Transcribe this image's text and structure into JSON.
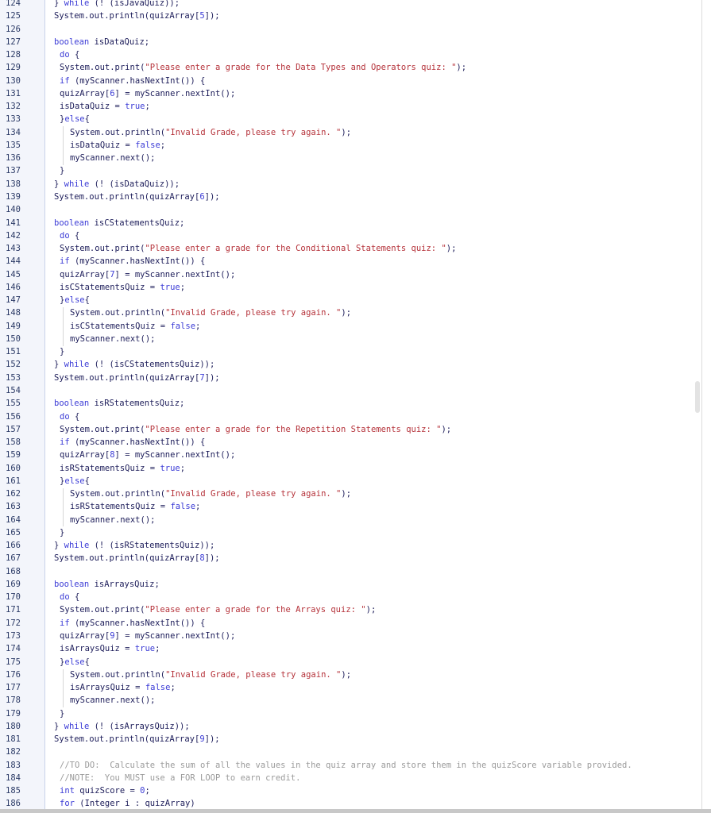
{
  "editor": {
    "colors": {
      "keyword": "#3b3bd6",
      "string": "#b5323a",
      "literal": "#3b3bd6",
      "comment": "#9a9a9a",
      "plain": "#1d1d5a",
      "line_number": "#2b3a66",
      "gutter_background": "#f3f5fb"
    },
    "lines": [
      {
        "n": "124",
        "indent": 0,
        "tokens": [
          [
            "p",
            "} "
          ],
          [
            "k",
            "while"
          ],
          [
            "p",
            " (! (isJavaQuiz));"
          ]
        ]
      },
      {
        "n": "125",
        "indent": 0,
        "tokens": [
          [
            "p",
            "System.out.println(quizArray["
          ],
          [
            "k",
            "5"
          ],
          [
            "p",
            "]);"
          ]
        ]
      },
      {
        "n": "126",
        "indent": 0,
        "tokens": []
      },
      {
        "n": "127",
        "indent": 0,
        "tokens": [
          [
            "k",
            "boolean"
          ],
          [
            "p",
            " isDataQuiz;"
          ]
        ]
      },
      {
        "n": "128",
        "indent": 1,
        "tokens": [
          [
            "k",
            "do"
          ],
          [
            "p",
            " {"
          ]
        ]
      },
      {
        "n": "129",
        "indent": 1,
        "tokens": [
          [
            "p",
            "System.out.print("
          ],
          [
            "s",
            "\"Please enter a grade for the Data Types and Operators quiz: \""
          ],
          [
            "p",
            ");"
          ]
        ]
      },
      {
        "n": "130",
        "indent": 1,
        "tokens": [
          [
            "k",
            "if"
          ],
          [
            "p",
            " (myScanner.hasNextInt()) {"
          ]
        ]
      },
      {
        "n": "131",
        "indent": 1,
        "tokens": [
          [
            "p",
            "quizArray["
          ],
          [
            "k",
            "6"
          ],
          [
            "p",
            "] = myScanner.nextInt();"
          ]
        ]
      },
      {
        "n": "132",
        "indent": 1,
        "tokens": [
          [
            "p",
            "isDataQuiz = "
          ],
          [
            "k",
            "true"
          ],
          [
            "p",
            ";"
          ]
        ]
      },
      {
        "n": "133",
        "indent": 1,
        "tokens": [
          [
            "p",
            "}"
          ],
          [
            "k",
            "else"
          ],
          [
            "p",
            "{"
          ]
        ]
      },
      {
        "n": "134",
        "indent": 3,
        "tokens": [
          [
            "p",
            "System.out.println("
          ],
          [
            "s",
            "\"Invalid Grade, please try again. \""
          ],
          [
            "p",
            ");"
          ]
        ]
      },
      {
        "n": "135",
        "indent": 3,
        "tokens": [
          [
            "p",
            "isDataQuiz = "
          ],
          [
            "k",
            "false"
          ],
          [
            "p",
            ";"
          ]
        ]
      },
      {
        "n": "136",
        "indent": 3,
        "tokens": [
          [
            "p",
            "myScanner.next();"
          ]
        ]
      },
      {
        "n": "137",
        "indent": 1,
        "tokens": [
          [
            "p",
            "}"
          ]
        ]
      },
      {
        "n": "138",
        "indent": 0,
        "tokens": [
          [
            "p",
            "} "
          ],
          [
            "k",
            "while"
          ],
          [
            "p",
            " (! (isDataQuiz));"
          ]
        ]
      },
      {
        "n": "139",
        "indent": 0,
        "tokens": [
          [
            "p",
            "System.out.println(quizArray["
          ],
          [
            "k",
            "6"
          ],
          [
            "p",
            "]);"
          ]
        ]
      },
      {
        "n": "140",
        "indent": 0,
        "tokens": []
      },
      {
        "n": "141",
        "indent": 0,
        "tokens": [
          [
            "k",
            "boolean"
          ],
          [
            "p",
            " isCStatementsQuiz;"
          ]
        ]
      },
      {
        "n": "142",
        "indent": 1,
        "tokens": [
          [
            "k",
            "do"
          ],
          [
            "p",
            " {"
          ]
        ]
      },
      {
        "n": "143",
        "indent": 1,
        "tokens": [
          [
            "p",
            "System.out.print("
          ],
          [
            "s",
            "\"Please enter a grade for the Conditional Statements quiz: \""
          ],
          [
            "p",
            ");"
          ]
        ]
      },
      {
        "n": "144",
        "indent": 1,
        "tokens": [
          [
            "k",
            "if"
          ],
          [
            "p",
            " (myScanner.hasNextInt()) {"
          ]
        ]
      },
      {
        "n": "145",
        "indent": 1,
        "tokens": [
          [
            "p",
            "quizArray["
          ],
          [
            "k",
            "7"
          ],
          [
            "p",
            "] = myScanner.nextInt();"
          ]
        ]
      },
      {
        "n": "146",
        "indent": 1,
        "tokens": [
          [
            "p",
            "isCStatementsQuiz = "
          ],
          [
            "k",
            "true"
          ],
          [
            "p",
            ";"
          ]
        ]
      },
      {
        "n": "147",
        "indent": 1,
        "tokens": [
          [
            "p",
            "}"
          ],
          [
            "k",
            "else"
          ],
          [
            "p",
            "{"
          ]
        ]
      },
      {
        "n": "148",
        "indent": 3,
        "tokens": [
          [
            "p",
            "System.out.println("
          ],
          [
            "s",
            "\"Invalid Grade, please try again. \""
          ],
          [
            "p",
            ");"
          ]
        ]
      },
      {
        "n": "149",
        "indent": 3,
        "tokens": [
          [
            "p",
            "isCStatementsQuiz = "
          ],
          [
            "k",
            "false"
          ],
          [
            "p",
            ";"
          ]
        ]
      },
      {
        "n": "150",
        "indent": 3,
        "tokens": [
          [
            "p",
            "myScanner.next();"
          ]
        ]
      },
      {
        "n": "151",
        "indent": 1,
        "tokens": [
          [
            "p",
            "}"
          ]
        ]
      },
      {
        "n": "152",
        "indent": 0,
        "tokens": [
          [
            "p",
            "} "
          ],
          [
            "k",
            "while"
          ],
          [
            "p",
            " (! (isCStatementsQuiz));"
          ]
        ]
      },
      {
        "n": "153",
        "indent": 0,
        "tokens": [
          [
            "p",
            "System.out.println(quizArray["
          ],
          [
            "k",
            "7"
          ],
          [
            "p",
            "]);"
          ]
        ]
      },
      {
        "n": "154",
        "indent": 0,
        "tokens": []
      },
      {
        "n": "155",
        "indent": 0,
        "tokens": [
          [
            "k",
            "boolean"
          ],
          [
            "p",
            " isRStatementsQuiz;"
          ]
        ]
      },
      {
        "n": "156",
        "indent": 1,
        "tokens": [
          [
            "k",
            "do"
          ],
          [
            "p",
            " {"
          ]
        ]
      },
      {
        "n": "157",
        "indent": 1,
        "tokens": [
          [
            "p",
            "System.out.print("
          ],
          [
            "s",
            "\"Please enter a grade for the Repetition Statements quiz: \""
          ],
          [
            "p",
            ");"
          ]
        ]
      },
      {
        "n": "158",
        "indent": 1,
        "tokens": [
          [
            "k",
            "if"
          ],
          [
            "p",
            " (myScanner.hasNextInt()) {"
          ]
        ]
      },
      {
        "n": "159",
        "indent": 1,
        "tokens": [
          [
            "p",
            "quizArray["
          ],
          [
            "k",
            "8"
          ],
          [
            "p",
            "] = myScanner.nextInt();"
          ]
        ]
      },
      {
        "n": "160",
        "indent": 1,
        "tokens": [
          [
            "p",
            "isRStatementsQuiz = "
          ],
          [
            "k",
            "true"
          ],
          [
            "p",
            ";"
          ]
        ]
      },
      {
        "n": "161",
        "indent": 1,
        "tokens": [
          [
            "p",
            "}"
          ],
          [
            "k",
            "else"
          ],
          [
            "p",
            "{"
          ]
        ]
      },
      {
        "n": "162",
        "indent": 3,
        "tokens": [
          [
            "p",
            "System.out.println("
          ],
          [
            "s",
            "\"Invalid Grade, please try again. \""
          ],
          [
            "p",
            ");"
          ]
        ]
      },
      {
        "n": "163",
        "indent": 3,
        "tokens": [
          [
            "p",
            "isRStatementsQuiz = "
          ],
          [
            "k",
            "false"
          ],
          [
            "p",
            ";"
          ]
        ]
      },
      {
        "n": "164",
        "indent": 3,
        "tokens": [
          [
            "p",
            "myScanner.next();"
          ]
        ]
      },
      {
        "n": "165",
        "indent": 1,
        "tokens": [
          [
            "p",
            "}"
          ]
        ]
      },
      {
        "n": "166",
        "indent": 0,
        "tokens": [
          [
            "p",
            "} "
          ],
          [
            "k",
            "while"
          ],
          [
            "p",
            " (! (isRStatementsQuiz));"
          ]
        ]
      },
      {
        "n": "167",
        "indent": 0,
        "tokens": [
          [
            "p",
            "System.out.println(quizArray["
          ],
          [
            "k",
            "8"
          ],
          [
            "p",
            "]);"
          ]
        ]
      },
      {
        "n": "168",
        "indent": 0,
        "tokens": []
      },
      {
        "n": "169",
        "indent": 0,
        "tokens": [
          [
            "k",
            "boolean"
          ],
          [
            "p",
            " isArraysQuiz;"
          ]
        ]
      },
      {
        "n": "170",
        "indent": 1,
        "tokens": [
          [
            "k",
            "do"
          ],
          [
            "p",
            " {"
          ]
        ]
      },
      {
        "n": "171",
        "indent": 1,
        "tokens": [
          [
            "p",
            "System.out.print("
          ],
          [
            "s",
            "\"Please enter a grade for the Arrays quiz: \""
          ],
          [
            "p",
            ");"
          ]
        ]
      },
      {
        "n": "172",
        "indent": 1,
        "tokens": [
          [
            "k",
            "if"
          ],
          [
            "p",
            " (myScanner.hasNextInt()) {"
          ]
        ]
      },
      {
        "n": "173",
        "indent": 1,
        "tokens": [
          [
            "p",
            "quizArray["
          ],
          [
            "k",
            "9"
          ],
          [
            "p",
            "] = myScanner.nextInt();"
          ]
        ]
      },
      {
        "n": "174",
        "indent": 1,
        "tokens": [
          [
            "p",
            "isArraysQuiz = "
          ],
          [
            "k",
            "true"
          ],
          [
            "p",
            ";"
          ]
        ]
      },
      {
        "n": "175",
        "indent": 1,
        "tokens": [
          [
            "p",
            "}"
          ],
          [
            "k",
            "else"
          ],
          [
            "p",
            "{"
          ]
        ]
      },
      {
        "n": "176",
        "indent": 3,
        "tokens": [
          [
            "p",
            "System.out.println("
          ],
          [
            "s",
            "\"Invalid Grade, please try again. \""
          ],
          [
            "p",
            ");"
          ]
        ]
      },
      {
        "n": "177",
        "indent": 3,
        "tokens": [
          [
            "p",
            "isArraysQuiz = "
          ],
          [
            "k",
            "false"
          ],
          [
            "p",
            ";"
          ]
        ]
      },
      {
        "n": "178",
        "indent": 3,
        "tokens": [
          [
            "p",
            "myScanner.next();"
          ]
        ]
      },
      {
        "n": "179",
        "indent": 1,
        "tokens": [
          [
            "p",
            "}"
          ]
        ]
      },
      {
        "n": "180",
        "indent": 0,
        "tokens": [
          [
            "p",
            "} "
          ],
          [
            "k",
            "while"
          ],
          [
            "p",
            " (! (isArraysQuiz));"
          ]
        ]
      },
      {
        "n": "181",
        "indent": 0,
        "tokens": [
          [
            "p",
            "System.out.println(quizArray["
          ],
          [
            "k",
            "9"
          ],
          [
            "p",
            "]);"
          ]
        ]
      },
      {
        "n": "182",
        "indent": 0,
        "tokens": []
      },
      {
        "n": "183",
        "indent": 1,
        "tokens": [
          [
            "c",
            "//TO DO:  Calculate the sum of all the values in the quiz array and store them in the quizScore variable provided."
          ]
        ]
      },
      {
        "n": "184",
        "indent": 1,
        "tokens": [
          [
            "c",
            "//NOTE:  You MUST use a FOR LOOP to earn credit."
          ]
        ]
      },
      {
        "n": "185",
        "indent": 1,
        "tokens": [
          [
            "k",
            "int"
          ],
          [
            "p",
            " quizScore = "
          ],
          [
            "k",
            "0"
          ],
          [
            "p",
            ";"
          ]
        ]
      },
      {
        "n": "186",
        "indent": 1,
        "tokens": [
          [
            "k",
            "for"
          ],
          [
            "p",
            " (Integer i : quizArray)"
          ]
        ]
      }
    ]
  }
}
